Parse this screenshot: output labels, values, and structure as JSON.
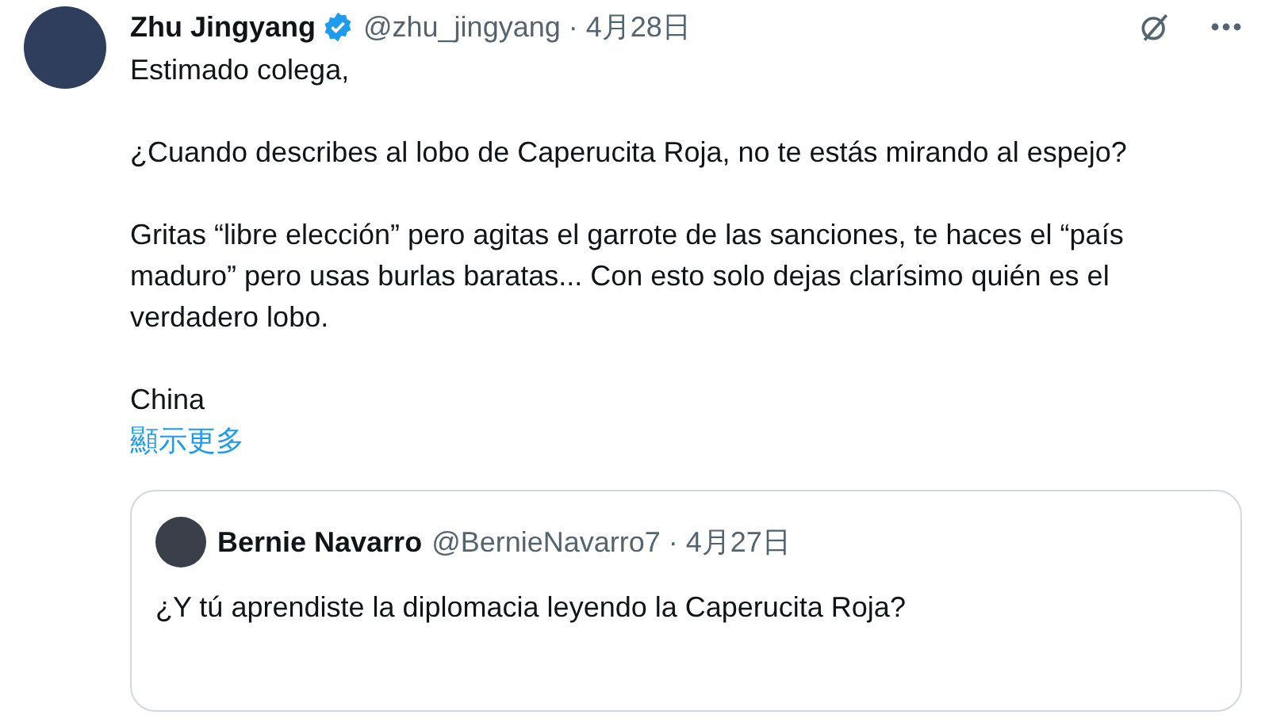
{
  "post": {
    "author": {
      "name": "Zhu Jingyang",
      "verified": true,
      "handle": "@zhu_jingyang",
      "separator": "·",
      "date": "4月28日"
    },
    "paragraphs": [
      "Estimado colega,",
      "¿Cuando describes al lobo de Caperucita Roja, no te estás mirando al espejo?",
      "Gritas “libre elección” pero agitas el garrote de las sanciones, te haces el “país maduro” pero usas burlas baratas... Con esto solo dejas clarísimo quién es el verdadero lobo.",
      "China"
    ],
    "show_more": "顯示更多",
    "quoted": {
      "author": {
        "name": "Bernie Navarro",
        "handle": "@BernieNavarro7",
        "separator": "·",
        "date": "4月27日"
      },
      "text": "¿Y tú aprendiste la diplomacia leyendo la Caperucita Roja?"
    }
  }
}
